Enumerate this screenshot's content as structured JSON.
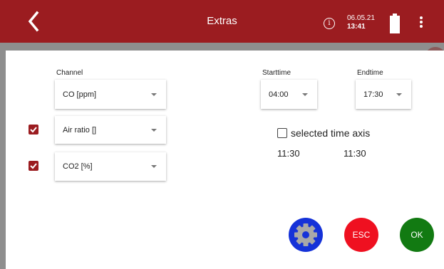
{
  "header": {
    "title": "Extras",
    "date": "06.05.21",
    "time": "13:41",
    "info_glyph": "i",
    "back_icon": "chevron-left-icon",
    "battery_icon": "battery-full-icon",
    "menu_icon": "kebab-menu-icon",
    "color": "#9b1c20"
  },
  "form": {
    "channel_label": "Channel",
    "channels": [
      {
        "value": "CO [ppm]",
        "checkable": false,
        "checked": false
      },
      {
        "value": "Air ratio []",
        "checkable": true,
        "checked": true
      },
      {
        "value": "CO2 [%]",
        "checkable": true,
        "checked": true
      }
    ],
    "starttime_label": "Starttime",
    "starttime_value": "04:00",
    "endtime_label": "Endtime",
    "endtime_value": "17:30",
    "axis_checkbox_label": "selected time axis",
    "axis_checked": false,
    "axis_start": "11:30",
    "axis_end": "11:30"
  },
  "buttons": {
    "settings_icon": "gear-icon",
    "settings_color": "#1532d8",
    "esc_label": "ESC",
    "esc_color": "#ef1020",
    "ok_label": "OK",
    "ok_color": "#127a12"
  }
}
